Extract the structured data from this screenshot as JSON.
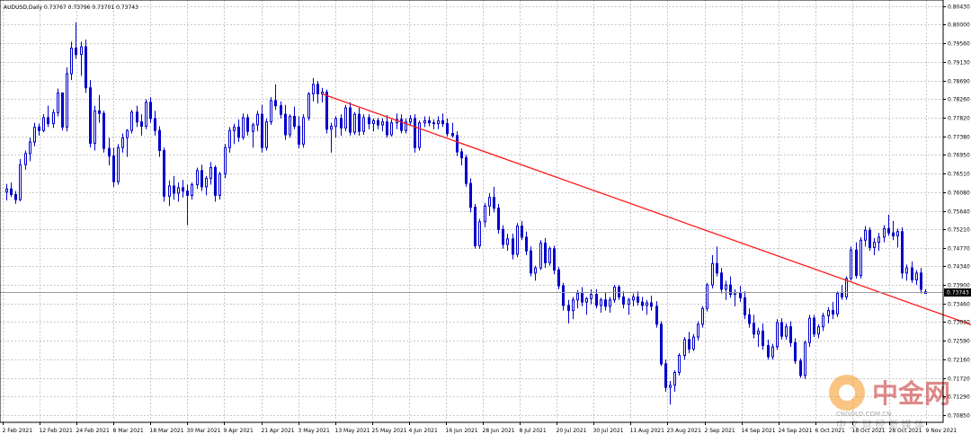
{
  "chart_data": {
    "type": "candlestick",
    "title": "AUDUSD,Daily  0.73767 0.73796 0.73701 0.73743",
    "ylim": [
      0.7085,
      0.8043
    ],
    "y_ticks": [
      0.8043,
      0.8,
      0.7956,
      0.7913,
      0.7869,
      0.7826,
      0.7782,
      0.7738,
      0.7695,
      0.7651,
      0.7608,
      0.7564,
      0.7521,
      0.7477,
      0.7434,
      0.739,
      0.7346,
      0.7303,
      0.7259,
      0.7216,
      0.7172,
      0.7129,
      0.7085
    ],
    "y_tick_labels": [
      "0.80430",
      "0.80000",
      "0.79560",
      "0.79130",
      "0.78690",
      "0.78260",
      "0.77820",
      "0.77380",
      "0.76950",
      "0.76510",
      "0.76080",
      "0.75640",
      "0.75210",
      "0.74770",
      "0.74340",
      "0.73900",
      "0.73460",
      "0.73030",
      "0.72590",
      "0.72160",
      "0.71720",
      "0.71290",
      "0.70850"
    ],
    "x_tick_labels": [
      "2 Feb 2021",
      "12 Feb 2021",
      "24 Feb 2021",
      "8 Mar 2021",
      "18 Mar 2021",
      "30 Mar 2021",
      "9 Apr 2021",
      "21 Apr 2021",
      "3 May 2021",
      "13 May 2021",
      "25 May 2021",
      "4 Jun 2021",
      "16 Jun 2021",
      "28 Jun 2021",
      "8 Jul 2021",
      "20 Jul 2021",
      "30 Jul 2021",
      "11 Aug 2021",
      "23 Aug 2021",
      "2 Sep 2021",
      "14 Sep 2021",
      "24 Sep 2021",
      "6 Oct 2021",
      "18 Oct 2021",
      "28 Oct 2021",
      "9 Nov 2021"
    ],
    "current_price": 0.73743,
    "current_price_label": "0.73743",
    "trendline": {
      "start_bar": 68,
      "start_price": 0.7838,
      "end_bar": 219,
      "end_price": 0.7254
    },
    "ohlc": [
      [
        0.7608,
        0.7627,
        0.7588,
        0.7615
      ],
      [
        0.7615,
        0.763,
        0.7596,
        0.7602
      ],
      [
        0.7602,
        0.761,
        0.758,
        0.759
      ],
      [
        0.759,
        0.7685,
        0.7586,
        0.7672
      ],
      [
        0.7672,
        0.7705,
        0.766,
        0.7698
      ],
      [
        0.7698,
        0.7735,
        0.768,
        0.7725
      ],
      [
        0.7725,
        0.777,
        0.7715,
        0.776
      ],
      [
        0.776,
        0.7768,
        0.774,
        0.7752
      ],
      [
        0.7752,
        0.779,
        0.7748,
        0.7782
      ],
      [
        0.7782,
        0.781,
        0.776,
        0.7768
      ],
      [
        0.7768,
        0.7802,
        0.7758,
        0.7794
      ],
      [
        0.7794,
        0.785,
        0.7785,
        0.784
      ],
      [
        0.784,
        0.7822,
        0.7752,
        0.776
      ],
      [
        0.776,
        0.79,
        0.775,
        0.7885
      ],
      [
        0.7885,
        0.796,
        0.787,
        0.7945
      ],
      [
        0.7945,
        0.8005,
        0.792,
        0.793
      ],
      [
        0.793,
        0.796,
        0.788,
        0.7948
      ],
      [
        0.7948,
        0.7965,
        0.784,
        0.7852
      ],
      [
        0.7852,
        0.787,
        0.7712,
        0.7722
      ],
      [
        0.7722,
        0.781,
        0.7705,
        0.7798
      ],
      [
        0.7798,
        0.7835,
        0.777,
        0.7792
      ],
      [
        0.7792,
        0.7798,
        0.77,
        0.771
      ],
      [
        0.771,
        0.7735,
        0.767,
        0.7692
      ],
      [
        0.7692,
        0.7712,
        0.762,
        0.7632
      ],
      [
        0.7632,
        0.772,
        0.7625,
        0.7712
      ],
      [
        0.7712,
        0.7745,
        0.77,
        0.7735
      ],
      [
        0.7735,
        0.7755,
        0.769,
        0.7752
      ],
      [
        0.7752,
        0.78,
        0.7745,
        0.7795
      ],
      [
        0.7795,
        0.781,
        0.776,
        0.7772
      ],
      [
        0.7772,
        0.779,
        0.774,
        0.7762
      ],
      [
        0.7762,
        0.7825,
        0.7755,
        0.7818
      ],
      [
        0.7818,
        0.783,
        0.777,
        0.778
      ],
      [
        0.778,
        0.7798,
        0.774,
        0.7752
      ],
      [
        0.7752,
        0.7762,
        0.769,
        0.7705
      ],
      [
        0.7705,
        0.7712,
        0.7585,
        0.7598
      ],
      [
        0.7598,
        0.7635,
        0.7575,
        0.7622
      ],
      [
        0.7622,
        0.7645,
        0.759,
        0.7605
      ],
      [
        0.7605,
        0.763,
        0.7585,
        0.7618
      ],
      [
        0.7618,
        0.7636,
        0.7595,
        0.761
      ],
      [
        0.761,
        0.7625,
        0.753,
        0.76
      ],
      [
        0.76,
        0.763,
        0.759,
        0.7625
      ],
      [
        0.7625,
        0.7665,
        0.7615,
        0.7658
      ],
      [
        0.7658,
        0.7672,
        0.761,
        0.762
      ],
      [
        0.762,
        0.7645,
        0.76,
        0.764
      ],
      [
        0.764,
        0.7678,
        0.7625,
        0.7665
      ],
      [
        0.7665,
        0.767,
        0.7585,
        0.76
      ],
      [
        0.76,
        0.7655,
        0.759,
        0.765
      ],
      [
        0.765,
        0.772,
        0.764,
        0.7712
      ],
      [
        0.7712,
        0.776,
        0.77,
        0.7752
      ],
      [
        0.7752,
        0.7768,
        0.772,
        0.776
      ],
      [
        0.776,
        0.7778,
        0.7725,
        0.7736
      ],
      [
        0.7736,
        0.7792,
        0.773,
        0.7782
      ],
      [
        0.7782,
        0.779,
        0.774,
        0.775
      ],
      [
        0.775,
        0.777,
        0.7712,
        0.7765
      ],
      [
        0.7765,
        0.7798,
        0.775,
        0.779
      ],
      [
        0.779,
        0.7812,
        0.77,
        0.7712
      ],
      [
        0.7712,
        0.778,
        0.7705,
        0.7772
      ],
      [
        0.7772,
        0.783,
        0.7765,
        0.7822
      ],
      [
        0.7822,
        0.786,
        0.78,
        0.781
      ],
      [
        0.781,
        0.782,
        0.778,
        0.779
      ],
      [
        0.779,
        0.7812,
        0.773,
        0.7742
      ],
      [
        0.7742,
        0.779,
        0.7735,
        0.7785
      ],
      [
        0.7785,
        0.7808,
        0.7755,
        0.7762
      ],
      [
        0.7762,
        0.7785,
        0.771,
        0.772
      ],
      [
        0.772,
        0.779,
        0.7712,
        0.7782
      ],
      [
        0.7782,
        0.7842,
        0.7775,
        0.7838
      ],
      [
        0.7838,
        0.7875,
        0.782,
        0.786
      ],
      [
        0.786,
        0.7868,
        0.7815,
        0.7838
      ],
      [
        0.7838,
        0.7852,
        0.7818,
        0.7842
      ],
      [
        0.7842,
        0.7848,
        0.7745,
        0.7755
      ],
      [
        0.7755,
        0.777,
        0.77,
        0.7762
      ],
      [
        0.7762,
        0.7785,
        0.7735,
        0.778
      ],
      [
        0.778,
        0.779,
        0.774,
        0.7758
      ],
      [
        0.7758,
        0.7812,
        0.775,
        0.7805
      ],
      [
        0.7805,
        0.7818,
        0.774,
        0.7748
      ],
      [
        0.7748,
        0.7795,
        0.7742,
        0.779
      ],
      [
        0.779,
        0.7805,
        0.774,
        0.775
      ],
      [
        0.775,
        0.779,
        0.7742,
        0.7782
      ],
      [
        0.7782,
        0.779,
        0.7755,
        0.7768
      ],
      [
        0.7768,
        0.778,
        0.775,
        0.7775
      ],
      [
        0.7775,
        0.7782,
        0.7755,
        0.7765
      ],
      [
        0.7765,
        0.778,
        0.775,
        0.7772
      ],
      [
        0.7772,
        0.7788,
        0.7735,
        0.7742
      ],
      [
        0.7742,
        0.7778,
        0.7738,
        0.777
      ],
      [
        0.777,
        0.7792,
        0.7755,
        0.7778
      ],
      [
        0.7778,
        0.779,
        0.7745,
        0.7752
      ],
      [
        0.7752,
        0.778,
        0.7745,
        0.7772
      ],
      [
        0.7772,
        0.7788,
        0.7765,
        0.778
      ],
      [
        0.778,
        0.779,
        0.77,
        0.7712
      ],
      [
        0.7712,
        0.7775,
        0.7705,
        0.777
      ],
      [
        0.777,
        0.7785,
        0.776,
        0.7775
      ],
      [
        0.7775,
        0.7785,
        0.7762,
        0.777
      ],
      [
        0.777,
        0.7778,
        0.7755,
        0.7768
      ],
      [
        0.7768,
        0.7785,
        0.7755,
        0.7775
      ],
      [
        0.7775,
        0.7792,
        0.776,
        0.7768
      ],
      [
        0.7768,
        0.778,
        0.7738,
        0.7745
      ],
      [
        0.7745,
        0.777,
        0.7735,
        0.774
      ],
      [
        0.774,
        0.775,
        0.7692,
        0.7702
      ],
      [
        0.7702,
        0.771,
        0.767,
        0.7688
      ],
      [
        0.7688,
        0.7695,
        0.762,
        0.7628
      ],
      [
        0.7628,
        0.764,
        0.756,
        0.7572
      ],
      [
        0.7572,
        0.758,
        0.7475,
        0.7482
      ],
      [
        0.7482,
        0.7545,
        0.7475,
        0.7538
      ],
      [
        0.7538,
        0.7582,
        0.7525,
        0.7575
      ],
      [
        0.7575,
        0.7605,
        0.7552,
        0.7595
      ],
      [
        0.7595,
        0.762,
        0.756,
        0.757
      ],
      [
        0.757,
        0.758,
        0.751,
        0.752
      ],
      [
        0.752,
        0.753,
        0.7475,
        0.7485
      ],
      [
        0.7485,
        0.751,
        0.747,
        0.7498
      ],
      [
        0.7498,
        0.751,
        0.745,
        0.7462
      ],
      [
        0.7462,
        0.7535,
        0.7455,
        0.7528
      ],
      [
        0.7528,
        0.754,
        0.7495,
        0.7502
      ],
      [
        0.7502,
        0.7515,
        0.746,
        0.747
      ],
      [
        0.747,
        0.748,
        0.741,
        0.7418
      ],
      [
        0.7418,
        0.7435,
        0.74,
        0.743
      ],
      [
        0.743,
        0.7495,
        0.7425,
        0.7488
      ],
      [
        0.7488,
        0.75,
        0.743,
        0.7442
      ],
      [
        0.7442,
        0.748,
        0.7435,
        0.7475
      ],
      [
        0.7475,
        0.7482,
        0.7415,
        0.7425
      ],
      [
        0.7425,
        0.7432,
        0.738,
        0.7388
      ],
      [
        0.7388,
        0.7395,
        0.733,
        0.7342
      ],
      [
        0.7342,
        0.7355,
        0.73,
        0.733
      ],
      [
        0.733,
        0.7362,
        0.731,
        0.7355
      ],
      [
        0.7355,
        0.7378,
        0.7335,
        0.737
      ],
      [
        0.737,
        0.7385,
        0.734,
        0.735
      ],
      [
        0.735,
        0.7362,
        0.732,
        0.7358
      ],
      [
        0.7358,
        0.738,
        0.7345,
        0.7368
      ],
      [
        0.7368,
        0.738,
        0.7335,
        0.7342
      ],
      [
        0.7342,
        0.736,
        0.7325,
        0.7355
      ],
      [
        0.7355,
        0.7372,
        0.733,
        0.734
      ],
      [
        0.734,
        0.7362,
        0.7325,
        0.7355
      ],
      [
        0.7355,
        0.739,
        0.7348,
        0.7385
      ],
      [
        0.7385,
        0.739,
        0.7355,
        0.7362
      ],
      [
        0.7362,
        0.7375,
        0.7335,
        0.7345
      ],
      [
        0.7345,
        0.736,
        0.732,
        0.7355
      ],
      [
        0.7355,
        0.737,
        0.734,
        0.7362
      ],
      [
        0.7362,
        0.7375,
        0.7342,
        0.735
      ],
      [
        0.735,
        0.7362,
        0.733,
        0.7342
      ],
      [
        0.7342,
        0.7355,
        0.732,
        0.7348
      ],
      [
        0.7348,
        0.7365,
        0.733,
        0.734
      ],
      [
        0.734,
        0.7352,
        0.729,
        0.7298
      ],
      [
        0.7298,
        0.7305,
        0.72,
        0.7205
      ],
      [
        0.7205,
        0.7215,
        0.714,
        0.715
      ],
      [
        0.715,
        0.7165,
        0.711,
        0.7155
      ],
      [
        0.7155,
        0.719,
        0.714,
        0.7185
      ],
      [
        0.7185,
        0.723,
        0.7178,
        0.7225
      ],
      [
        0.7225,
        0.7268,
        0.7215,
        0.7262
      ],
      [
        0.7262,
        0.728,
        0.723,
        0.724
      ],
      [
        0.724,
        0.7275,
        0.7235,
        0.7268
      ],
      [
        0.7268,
        0.7305,
        0.726,
        0.7298
      ],
      [
        0.7298,
        0.734,
        0.729,
        0.7335
      ],
      [
        0.7335,
        0.7395,
        0.7328,
        0.739
      ],
      [
        0.739,
        0.746,
        0.7382,
        0.744
      ],
      [
        0.744,
        0.748,
        0.741,
        0.7418
      ],
      [
        0.7418,
        0.743,
        0.737,
        0.738
      ],
      [
        0.738,
        0.74,
        0.7355,
        0.739
      ],
      [
        0.739,
        0.741,
        0.736,
        0.7368
      ],
      [
        0.7368,
        0.738,
        0.734,
        0.7372
      ],
      [
        0.7372,
        0.7388,
        0.735,
        0.736
      ],
      [
        0.736,
        0.7375,
        0.731,
        0.732
      ],
      [
        0.732,
        0.7335,
        0.729,
        0.73
      ],
      [
        0.73,
        0.732,
        0.7265,
        0.7275
      ],
      [
        0.7275,
        0.729,
        0.7245,
        0.7282
      ],
      [
        0.7282,
        0.73,
        0.7238,
        0.7248
      ],
      [
        0.7248,
        0.7262,
        0.7215,
        0.7222
      ],
      [
        0.7222,
        0.7252,
        0.7215,
        0.7245
      ],
      [
        0.7245,
        0.731,
        0.7238,
        0.7302
      ],
      [
        0.7302,
        0.7312,
        0.7262,
        0.727
      ],
      [
        0.727,
        0.73,
        0.7262,
        0.7292
      ],
      [
        0.7292,
        0.7305,
        0.7245,
        0.7255
      ],
      [
        0.7255,
        0.7265,
        0.7205,
        0.7212
      ],
      [
        0.7212,
        0.7218,
        0.7172,
        0.7178
      ],
      [
        0.7178,
        0.726,
        0.717,
        0.7255
      ],
      [
        0.7255,
        0.732,
        0.7245,
        0.7312
      ],
      [
        0.7312,
        0.732,
        0.7268,
        0.7275
      ],
      [
        0.7275,
        0.7298,
        0.7265,
        0.7292
      ],
      [
        0.7292,
        0.7325,
        0.7282,
        0.7318
      ],
      [
        0.7318,
        0.7338,
        0.73,
        0.733
      ],
      [
        0.733,
        0.735,
        0.731,
        0.7322
      ],
      [
        0.7322,
        0.7375,
        0.7315,
        0.737
      ],
      [
        0.737,
        0.739,
        0.7355,
        0.7362
      ],
      [
        0.7362,
        0.741,
        0.7355,
        0.7405
      ],
      [
        0.7405,
        0.748,
        0.74,
        0.7472
      ],
      [
        0.7472,
        0.749,
        0.7405,
        0.7412
      ],
      [
        0.7412,
        0.7502,
        0.7405,
        0.7495
      ],
      [
        0.7495,
        0.7528,
        0.748,
        0.7518
      ],
      [
        0.7518,
        0.7525,
        0.747,
        0.7478
      ],
      [
        0.7478,
        0.75,
        0.746,
        0.749
      ],
      [
        0.749,
        0.7512,
        0.747,
        0.7502
      ],
      [
        0.7502,
        0.753,
        0.749,
        0.7522
      ],
      [
        0.7522,
        0.7555,
        0.7505,
        0.7512
      ],
      [
        0.7512,
        0.754,
        0.7495,
        0.7505
      ],
      [
        0.7505,
        0.7522,
        0.7478,
        0.7515
      ],
      [
        0.7515,
        0.7525,
        0.7405,
        0.7418
      ],
      [
        0.7418,
        0.7438,
        0.74,
        0.743
      ],
      [
        0.743,
        0.7445,
        0.7395,
        0.7402
      ],
      [
        0.7402,
        0.7425,
        0.739,
        0.7418
      ],
      [
        0.7418,
        0.743,
        0.737,
        0.738
      ],
      [
        0.737,
        0.738,
        0.737,
        0.7374
      ]
    ]
  },
  "watermark": {
    "brand": "中金网",
    "domain": "CNGOLD.COM.CN",
    "slogan": "中 文 财 经 新 媒 体"
  }
}
